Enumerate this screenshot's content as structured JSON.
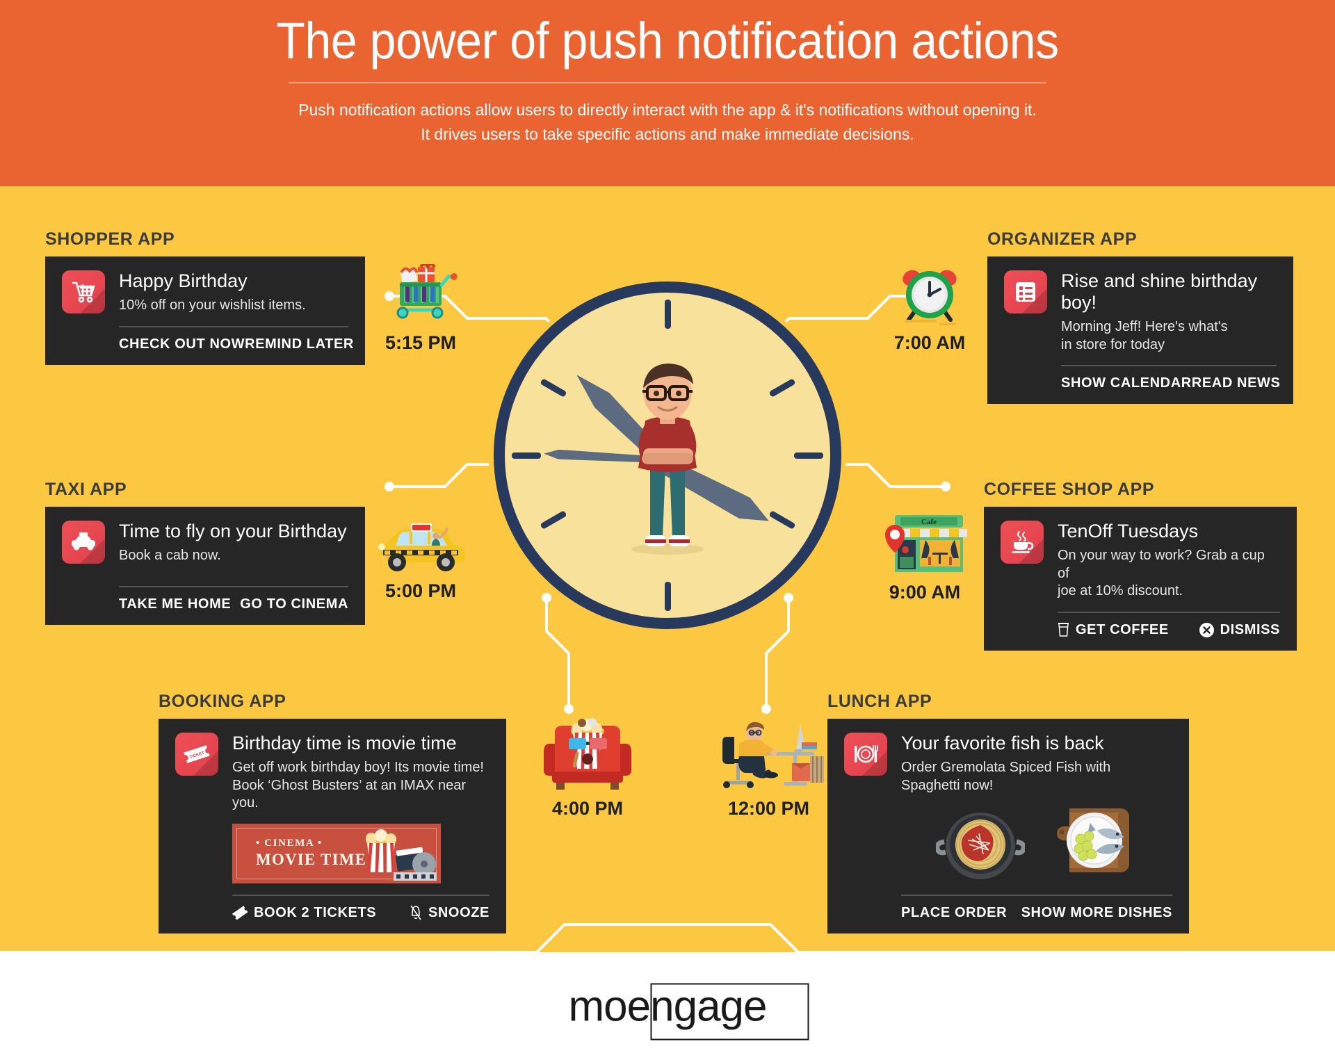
{
  "header": {
    "title": "The power of push notification actions",
    "subtitle_line1": "Push notification actions allow users to directly interact with the app & it's notifications without opening it.",
    "subtitle_line2": "It drives users to take specific actions and make immediate decisions."
  },
  "colors": {
    "header_bg": "#ea6432",
    "page_bg": "#fcc842",
    "card_bg": "#262626",
    "icon_red": "#ef4f56",
    "clock_rim": "#27395c",
    "clock_face": "#f8e19b",
    "footer_bg": "#ffffff"
  },
  "apps": [
    {
      "id": "shopper",
      "label": "SHOPPER APP",
      "icon": "shopping-cart-icon",
      "title": "Happy Birthday",
      "text": "10% off on your wishlist items.",
      "actions": [
        {
          "label": "CHECK OUT NOW",
          "icon": ""
        },
        {
          "label": "REMIND LATER",
          "icon": ""
        }
      ]
    },
    {
      "id": "organizer",
      "label": "ORGANIZER APP",
      "icon": "list-icon",
      "title": "Rise and shine birthday boy!",
      "text": "Morning Jeff! Here's what's\nin store for today",
      "actions": [
        {
          "label": "SHOW CALENDAR",
          "icon": ""
        },
        {
          "label": "READ NEWS",
          "icon": ""
        }
      ]
    },
    {
      "id": "taxi",
      "label": "TAXI APP",
      "icon": "taxi-icon",
      "title": "Time to fly on your Birthday",
      "text": "Book a cab now.",
      "actions": [
        {
          "label": "TAKE ME HOME",
          "icon": ""
        },
        {
          "label": "GO TO CINEMA",
          "icon": ""
        }
      ]
    },
    {
      "id": "coffee",
      "label": "COFFEE SHOP APP",
      "icon": "coffee-cup-icon",
      "title": "TenOff Tuesdays",
      "text": "On your way to work? Grab a cup of\njoe at 10% discount.",
      "actions": [
        {
          "label": "GET COFFEE",
          "icon": "coffee-togo-icon"
        },
        {
          "label": "DISMISS",
          "icon": "close-circle-icon"
        }
      ]
    },
    {
      "id": "booking",
      "label": "BOOKING APP",
      "icon": "ticket-icon",
      "title": "Birthday time is movie time",
      "text": "Get off work birthday boy! Its movie time!\nBook ‘Ghost Busters’ at an IMAX near you.",
      "banner": {
        "small": "• CINEMA •",
        "big": "MOVIE TIME"
      },
      "actions": [
        {
          "label": "BOOK 2 TICKETS",
          "icon": "ticket-stub-icon"
        },
        {
          "label": "SNOOZE",
          "icon": "bell-off-icon"
        }
      ]
    },
    {
      "id": "lunch",
      "label": "LUNCH APP",
      "icon": "plate-cutlery-icon",
      "title": "Your favorite fish is back",
      "text": "Order Gremolata Spiced Fish with\nSpaghetti now!",
      "actions": [
        {
          "label": "PLACE ORDER",
          "icon": ""
        },
        {
          "label": "SHOW MORE DISHES",
          "icon": ""
        }
      ]
    }
  ],
  "timeline": [
    {
      "id": "shopper-time",
      "time": "5:15 PM",
      "art": "gift-cart-icon"
    },
    {
      "id": "organizer-time",
      "time": "7:00 AM",
      "art": "alarm-clock-icon"
    },
    {
      "id": "taxi-time",
      "time": "5:00 PM",
      "art": "taxi-cab-icon"
    },
    {
      "id": "coffee-time",
      "time": "9:00 AM",
      "art": "cafe-storefront-icon"
    },
    {
      "id": "booking-time",
      "time": "4:00 PM",
      "art": "cinema-seat-popcorn-icon"
    },
    {
      "id": "lunch-time",
      "time": "12:00 PM",
      "art": "office-desk-icon"
    }
  ],
  "footer": {
    "logo_part1": "mo",
    "logo_part2": "engage"
  }
}
